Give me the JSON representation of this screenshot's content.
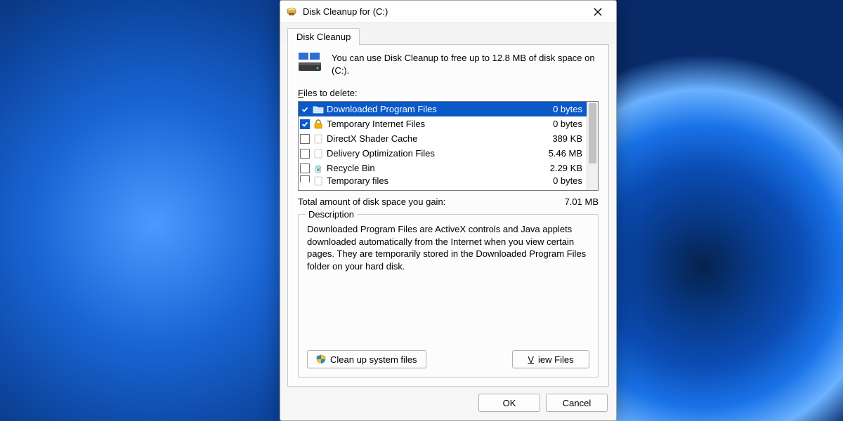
{
  "window": {
    "title": "Disk Cleanup for  (C:)"
  },
  "tab": {
    "label": "Disk Cleanup"
  },
  "intro": "You can use Disk Cleanup to free up to 12.8 MB of disk space on  (C:).",
  "files_label": "Files to delete:",
  "items": [
    {
      "name": "Downloaded Program Files",
      "size": "0 bytes",
      "checked": true,
      "selected": true,
      "icon": "folder"
    },
    {
      "name": "Temporary Internet Files",
      "size": "0 bytes",
      "checked": true,
      "selected": false,
      "icon": "lock"
    },
    {
      "name": "DirectX Shader Cache",
      "size": "389 KB",
      "checked": false,
      "selected": false,
      "icon": "blank"
    },
    {
      "name": "Delivery Optimization Files",
      "size": "5.46 MB",
      "checked": false,
      "selected": false,
      "icon": "blank"
    },
    {
      "name": "Recycle Bin",
      "size": "2.29 KB",
      "checked": false,
      "selected": false,
      "icon": "recycle"
    },
    {
      "name": "Temporary files",
      "size": "0 bytes",
      "checked": false,
      "selected": false,
      "icon": "blank",
      "cut": true
    }
  ],
  "total_label": "Total amount of disk space you gain:",
  "total_value": "7.01 MB",
  "description": {
    "legend": "Description",
    "text": "Downloaded Program Files are ActiveX controls and Java applets downloaded automatically from the Internet when you view certain pages. They are temporarily stored in the Downloaded Program Files folder on your hard disk."
  },
  "buttons": {
    "clean_system": "Clean up system files",
    "view_files": "View Files",
    "ok": "OK",
    "cancel": "Cancel"
  }
}
